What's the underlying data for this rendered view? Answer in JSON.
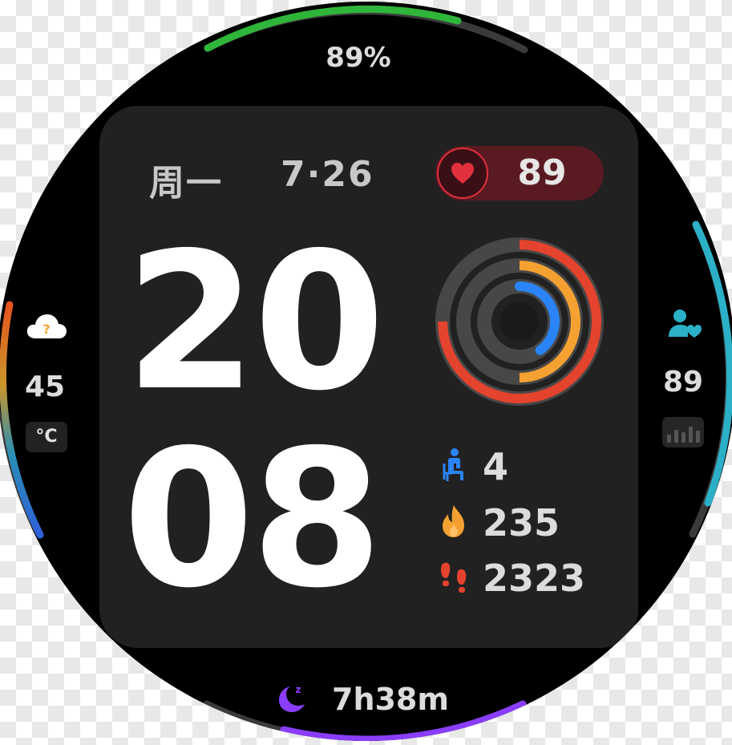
{
  "watch": {
    "battery": {
      "label": "89%",
      "percent": 89,
      "color": "#2fb63a"
    },
    "date": {
      "weekday": "周一",
      "date": "7·26"
    },
    "heart_rate": {
      "value": "89",
      "accent": "#e2303d"
    },
    "time": {
      "hours": "20",
      "minutes": "08"
    },
    "activity_rings": {
      "outer": {
        "fraction": 0.75,
        "color": "#e4432e"
      },
      "middle": {
        "fraction": 0.5,
        "color": "#f5a132"
      },
      "inner": {
        "fraction": 0.4,
        "color": "#2a84f7"
      }
    },
    "stats": [
      {
        "icon": "sitting-person-icon",
        "value": "4",
        "color": "#2a84f7"
      },
      {
        "icon": "flame-icon",
        "value": "235",
        "color": "#f5a132"
      },
      {
        "icon": "footsteps-icon",
        "value": "2323",
        "color": "#e4432e"
      }
    ],
    "weather": {
      "icon": "cloud-question-icon",
      "value": "45",
      "unit": "°C"
    },
    "contacts": {
      "icon": "person-heart-icon",
      "value": "89",
      "color": "#2bb0c8"
    },
    "sleep": {
      "icon": "moon-sleep-icon",
      "value": "7h38m",
      "color": "#8b3dff"
    }
  }
}
